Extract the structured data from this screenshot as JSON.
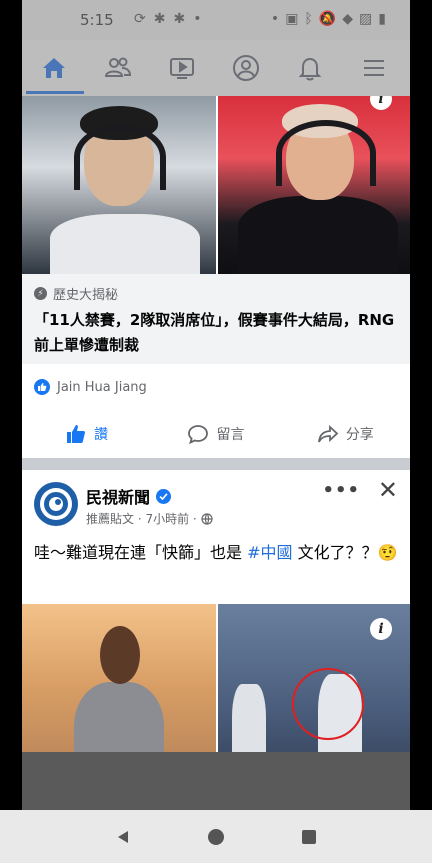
{
  "status_bar": {
    "time": "5:15",
    "left_icons": [
      "sync-icon",
      "android-icon",
      "android-icon",
      "dot-icon"
    ],
    "right_icons": [
      "dot-icon",
      "nfc-icon",
      "bluetooth-icon",
      "mute-icon",
      "wifi-icon",
      "no-sim-icon",
      "battery-icon"
    ]
  },
  "nav": {
    "items": [
      {
        "name": "home-icon",
        "active": true
      },
      {
        "name": "friends-icon",
        "active": false
      },
      {
        "name": "watch-icon",
        "active": false
      },
      {
        "name": "profile-icon",
        "active": false
      },
      {
        "name": "notifications-icon",
        "active": false
      },
      {
        "name": "menu-icon",
        "active": false
      }
    ],
    "accent": "#4a76b8"
  },
  "post1": {
    "link_source": "歷史大揭秘",
    "link_title": "「11人禁賽，2隊取消席位」，假賽事件大結局，RNG前上單慘遭制裁",
    "reaction_name": "Jain Hua Jiang",
    "actions": {
      "like": "讚",
      "comment": "留言",
      "share": "分享"
    }
  },
  "post2": {
    "page_name": "民視新聞",
    "meta": "推薦貼文 · 7小時前 ·",
    "text_before": "哇～難道現在連「快篩」也是 ",
    "hashtag": "#中國",
    "text_after": " 文化了？？🤨",
    "more": "•••",
    "close": "✕"
  },
  "system_nav": {
    "back": "back-icon",
    "home": "home-circle-icon",
    "recents": "recents-icon"
  }
}
